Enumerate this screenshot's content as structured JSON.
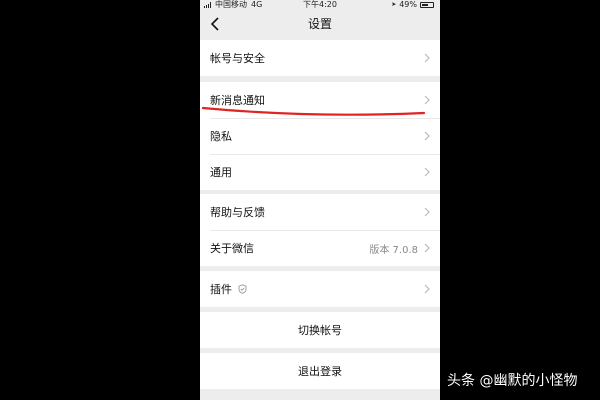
{
  "status_bar": {
    "carrier": "中国移动",
    "network": "4G",
    "time": "下午4:20",
    "battery": "49%"
  },
  "nav": {
    "title": "设置"
  },
  "groups": {
    "g1": {
      "account_security": "帐号与安全"
    },
    "g2": {
      "notifications": "新消息通知",
      "privacy": "隐私",
      "general": "通用"
    },
    "g3": {
      "help_feedback": "帮助与反馈",
      "about": "关于微信",
      "version": "版本 7.0.8"
    },
    "g4": {
      "plugins": "插件"
    },
    "g5": {
      "switch_account": "切换帐号"
    },
    "g6": {
      "logout": "退出登录"
    }
  },
  "annotation": {
    "underline_color": "#e02424"
  },
  "watermark": "头条 @幽默的小怪物"
}
